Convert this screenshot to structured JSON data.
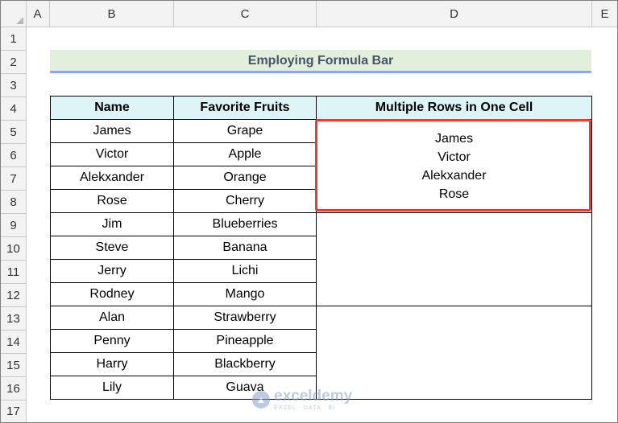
{
  "columns": [
    "A",
    "B",
    "C",
    "D",
    "E"
  ],
  "rows": [
    "1",
    "2",
    "3",
    "4",
    "5",
    "6",
    "7",
    "8",
    "9",
    "10",
    "11",
    "12",
    "13",
    "14",
    "15",
    "16",
    "17"
  ],
  "title": "Employing Formula Bar",
  "table": {
    "headers": [
      "Name",
      "Favorite Fruits",
      "Multiple Rows in One Cell"
    ],
    "rows": [
      [
        "James",
        "Grape"
      ],
      [
        "Victor",
        "Apple"
      ],
      [
        "Alekxander",
        "Orange"
      ],
      [
        "Rose",
        "Cherry"
      ],
      [
        "Jim",
        "Blueberries"
      ],
      [
        "Steve",
        "Banana"
      ],
      [
        "Jerry",
        "Lichi"
      ],
      [
        "Rodney",
        "Mango"
      ],
      [
        "Alan",
        "Strawberry"
      ],
      [
        "Penny",
        "Pineapple"
      ],
      [
        "Harry",
        "Blackberry"
      ],
      [
        "Lily",
        "Guava"
      ]
    ],
    "merged_lines": [
      "James",
      "Victor",
      "Alekxander",
      "Rose"
    ]
  },
  "watermark": {
    "brand": "exceldemy",
    "tagline": "EXCEL · DATA · BI"
  },
  "colors": {
    "title_fill": "#e2efda",
    "header_fill": "#ddf5f7",
    "highlight": "#e0403a"
  }
}
